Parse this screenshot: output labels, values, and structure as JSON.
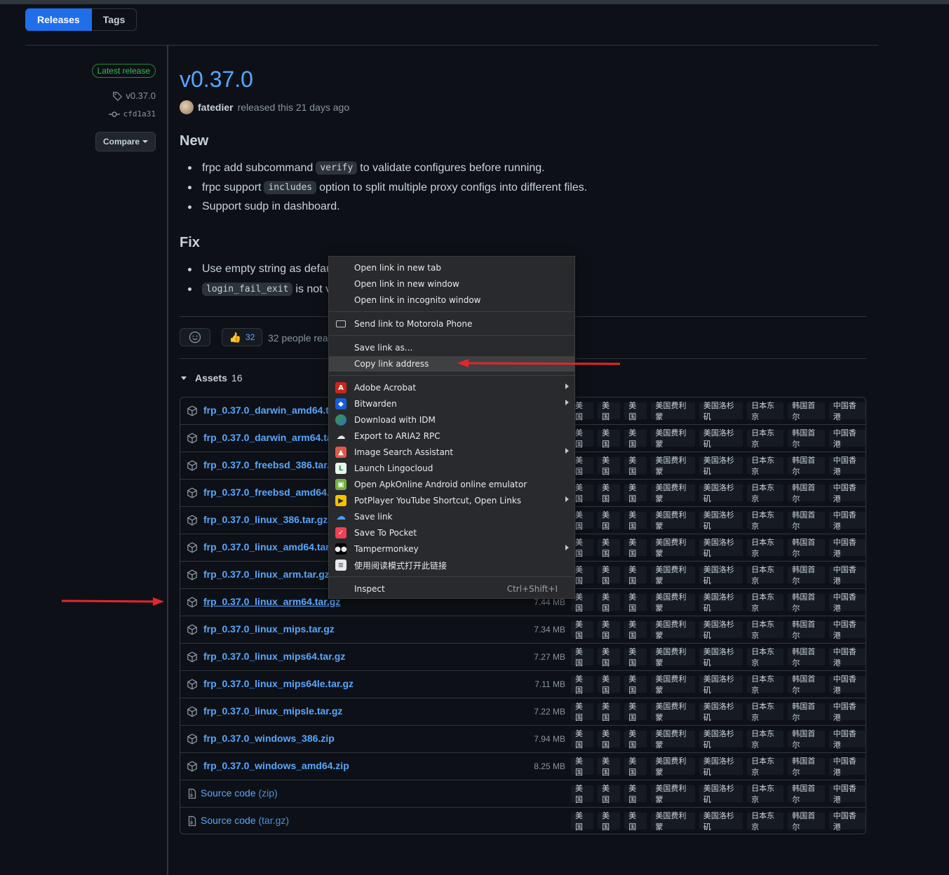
{
  "tabs": {
    "releases": "Releases",
    "tags": "Tags"
  },
  "sidebar": {
    "latest_badge": "Latest release",
    "tag": "v0.37.0",
    "commit": "cfd1a31",
    "compare": "Compare"
  },
  "release": {
    "title": "v0.37.0",
    "author": "fatedier",
    "released_text": "released this 21 days ago",
    "new_heading": "New",
    "new_items": [
      {
        "before": "frpc add subcommand",
        "code": "verify",
        "after": "to validate configures before running."
      },
      {
        "before": "frpc support",
        "code": "includes",
        "after": "option to split multiple proxy configs into different files."
      },
      {
        "before": "Support sudp in dashboard.",
        "code": "",
        "after": ""
      }
    ],
    "fix_heading": "Fix",
    "fix_items": [
      {
        "before": "Use empty string as defau",
        "code": "",
        "after": ""
      },
      {
        "before": "",
        "code": "login_fail_exit",
        "after": "is not v"
      }
    ],
    "reactions": {
      "thumbs_count": "32",
      "text": "32 people rea"
    },
    "assets_label": "Assets",
    "assets_count": "16"
  },
  "mirrors": [
    "美国",
    "美国",
    "美国",
    "美国费利蒙",
    "美国洛杉矶",
    "日本东京",
    "韩国首尔",
    "中国香港"
  ],
  "assets": [
    {
      "name": "frp_0.37.0_darwin_amd64.tar",
      "size": ""
    },
    {
      "name": "frp_0.37.0_darwin_arm64.tar",
      "size": ""
    },
    {
      "name": "frp_0.37.0_freebsd_386.tar.gz",
      "size": ""
    },
    {
      "name": "frp_0.37.0_freebsd_amd64.ta",
      "size": ""
    },
    {
      "name": "frp_0.37.0_linux_386.tar.gz",
      "size": ""
    },
    {
      "name": "frp_0.37.0_linux_amd64.tar.g",
      "size": ""
    },
    {
      "name": "frp_0.37.0_linux_arm.tar.gz",
      "size": ""
    },
    {
      "name": "frp_0.37.0_linux_arm64.tar.gz",
      "size": "7.44 MB"
    },
    {
      "name": "frp_0.37.0_linux_mips.tar.gz",
      "size": "7.34 MB"
    },
    {
      "name": "frp_0.37.0_linux_mips64.tar.gz",
      "size": "7.27 MB"
    },
    {
      "name": "frp_0.37.0_linux_mips64le.tar.gz",
      "size": "7.11 MB"
    },
    {
      "name": "frp_0.37.0_linux_mipsle.tar.gz",
      "size": "7.22 MB"
    },
    {
      "name": "frp_0.37.0_windows_386.zip",
      "size": "7.94 MB"
    },
    {
      "name": "frp_0.37.0_windows_amd64.zip",
      "size": "8.25 MB"
    }
  ],
  "sources": [
    {
      "name": "Source code",
      "ext": "(zip)"
    },
    {
      "name": "Source code",
      "ext": "(tar.gz)"
    }
  ],
  "context_menu": {
    "open_new_tab": "Open link in new tab",
    "open_new_window": "Open link in new window",
    "open_incognito": "Open link in incognito window",
    "send_to_phone": "Send link to Motorola Phone",
    "save_link_as": "Save link as...",
    "copy_link_address": "Copy link address",
    "adobe_acrobat": "Adobe Acrobat",
    "bitwarden": "Bitwarden",
    "download_idm": "Download with IDM",
    "export_aria2": "Export to ARIA2 RPC",
    "image_search": "Image Search Assistant",
    "lingocloud": "Launch Lingocloud",
    "apkonline": "Open ApkOnline Android online emulator",
    "potplayer": "PotPlayer YouTube Shortcut, Open Links",
    "save_link": "Save link",
    "pocket": "Save To Pocket",
    "tampermonkey": "Tampermonkey",
    "reader_mode": "使用阅读模式打开此链接",
    "inspect": "Inspect",
    "inspect_shortcut": "Ctrl+Shift+I"
  },
  "colors": {
    "accent": "#1f6feb",
    "link": "#58a6ff",
    "background": "#0d1117",
    "annotation_arrow": "#e5252b"
  }
}
